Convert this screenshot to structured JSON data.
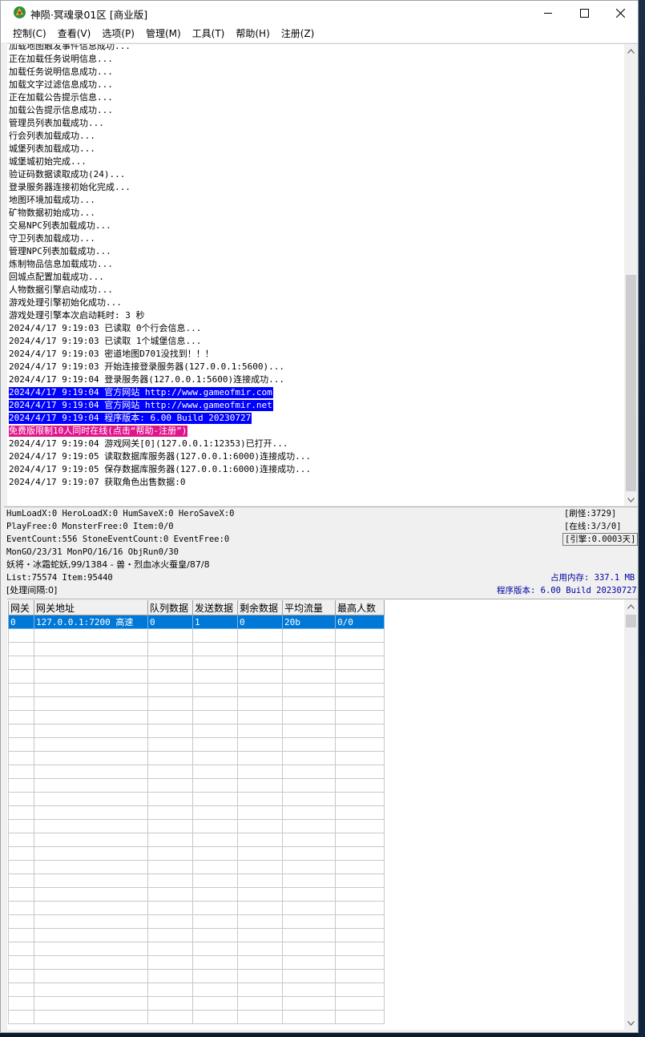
{
  "window": {
    "title": "神陨·冥魂录01区 [商业版]",
    "minimize_icon": "minimize-icon",
    "maximize_icon": "maximize-icon",
    "close_icon": "close-icon"
  },
  "menu": [
    {
      "label": "控制(C)"
    },
    {
      "label": "查看(V)"
    },
    {
      "label": "选项(P)"
    },
    {
      "label": "管理(M)"
    },
    {
      "label": "工具(T)"
    },
    {
      "label": "帮助(H)"
    },
    {
      "label": "注册(Z)"
    }
  ],
  "log": [
    {
      "text": "加载地图触发事件信息成功...",
      "hl": ""
    },
    {
      "text": "正在加载任务说明信息...",
      "hl": ""
    },
    {
      "text": "加载任务说明信息成功...",
      "hl": ""
    },
    {
      "text": "加载文字过滤信息成功...",
      "hl": ""
    },
    {
      "text": "正在加载公告提示信息...",
      "hl": ""
    },
    {
      "text": "加载公告提示信息成功...",
      "hl": ""
    },
    {
      "text": "管理员列表加载成功...",
      "hl": ""
    },
    {
      "text": "行会列表加载成功...",
      "hl": ""
    },
    {
      "text": "城堡列表加载成功...",
      "hl": ""
    },
    {
      "text": "城堡城初始完成...",
      "hl": ""
    },
    {
      "text": "验证码数据读取成功(24)...",
      "hl": ""
    },
    {
      "text": "登录服务器连接初始化完成...",
      "hl": ""
    },
    {
      "text": "地图环境加载成功...",
      "hl": ""
    },
    {
      "text": "矿物数据初始成功...",
      "hl": ""
    },
    {
      "text": "交易NPC列表加载成功...",
      "hl": ""
    },
    {
      "text": "守卫列表加载成功...",
      "hl": ""
    },
    {
      "text": "管理NPC列表加载成功...",
      "hl": ""
    },
    {
      "text": "炼制物品信息加载成功...",
      "hl": ""
    },
    {
      "text": "回城点配置加载成功...",
      "hl": ""
    },
    {
      "text": "人物数据引擎启动成功...",
      "hl": ""
    },
    {
      "text": "游戏处理引擎初始化成功...",
      "hl": ""
    },
    {
      "text": "游戏处理引擎本次启动耗时: 3 秒",
      "hl": ""
    },
    {
      "text": "2024/4/17 9:19:03 已读取 0个行会信息...",
      "hl": ""
    },
    {
      "text": "2024/4/17 9:19:03 已读取 1个城堡信息...",
      "hl": ""
    },
    {
      "text": "2024/4/17 9:19:03 密道地图D701没找到！！！",
      "hl": ""
    },
    {
      "text": "2024/4/17 9:19:03 开始连接登录服务器(127.0.0.1:5600)...",
      "hl": ""
    },
    {
      "text": "2024/4/17 9:19:04 登录服务器(127.0.0.1:5600)连接成功...",
      "hl": ""
    },
    {
      "text": "2024/4/17 9:19:04 官方网站 http://www.gameofmir.com",
      "hl": "blue"
    },
    {
      "text": "2024/4/17 9:19:04 官方网站 http://www.gameofmir.net",
      "hl": "blue"
    },
    {
      "text": "2024/4/17 9:19:04 程序版本: 6.00 Build 20230727",
      "hl": "blue"
    },
    {
      "text": "免费版限制10人同时在线(点击“帮助-注册”)",
      "hl": "pink"
    },
    {
      "text": "2024/4/17 9:19:04 游戏网关[0](127.0.0.1:12353)已打开...",
      "hl": ""
    },
    {
      "text": "2024/4/17 9:19:05 读取数据库服务器(127.0.0.1:6000)连接成功...",
      "hl": ""
    },
    {
      "text": "2024/4/17 9:19:05 保存数据库服务器(127.0.0.1:6000)连接成功...",
      "hl": ""
    },
    {
      "text": "2024/4/17 9:19:07 获取角色出售数据:0",
      "hl": ""
    }
  ],
  "status": {
    "line1": "HumLoadX:0 HeroLoadX:0 HumSaveX:0 HeroSaveX:0",
    "line2": "PlayFree:0 MonsterFree:0 Item:0/0",
    "line3": "EventCount:556 StoneEventCount:0 EventFree:0",
    "line4": "MonGO/23/31 MonPO/16/16 ObjRun0/30",
    "line5": "妖将・冰霜蛇妖,99/1384 - 兽・烈血冰火蚕皇/87/8",
    "line6": "List:75574 Item:95440",
    "line7": "[处理间隔:0]",
    "refresh": "[刷怪:3729]",
    "online": "[在线:3/3/0]",
    "engine": "[引擎:0.0003天]",
    "memory": "占用内存: 337.1 MB",
    "version": "程序版本: 6.00 Build 20230727"
  },
  "gateway_table": {
    "columns": [
      "网关",
      "网关地址",
      "队列数据",
      "发送数据",
      "剩余数据",
      "平均流量",
      "最高人数"
    ],
    "rows": [
      [
        "0",
        "127.0.0.1:7200 高速",
        "0",
        "1",
        "0",
        "20b",
        "0/0"
      ]
    ]
  }
}
